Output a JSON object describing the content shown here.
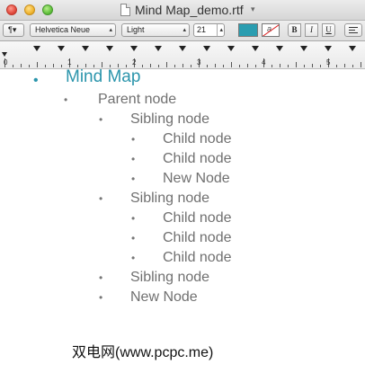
{
  "window": {
    "title": "Mind Map_demo.rtf",
    "title_menu_arrow": "▾"
  },
  "toolbar": {
    "paragraph_symbol": "¶▾",
    "font_family": "Helvetica Neue",
    "font_style": "Light",
    "font_size": "21",
    "text_color": "#2a9db0",
    "highlight_glyph": "a",
    "bold": "B",
    "italic": "I",
    "underline": "U"
  },
  "ruler": {
    "numbers": [
      "0",
      "1",
      "2",
      "3",
      "4",
      "5"
    ]
  },
  "document": {
    "items": [
      {
        "level": 0,
        "text": "Mind Map"
      },
      {
        "level": 1,
        "text": "Parent node"
      },
      {
        "level": 2,
        "text": "Sibling node"
      },
      {
        "level": 3,
        "text": "Child node"
      },
      {
        "level": 3,
        "text": "Child node"
      },
      {
        "level": 3,
        "text": "New Node"
      },
      {
        "level": 2,
        "text": "Sibling node"
      },
      {
        "level": 3,
        "text": "Child node"
      },
      {
        "level": 3,
        "text": "Child node"
      },
      {
        "level": 3,
        "text": "Child node"
      },
      {
        "level": 2,
        "text": "Sibling node"
      },
      {
        "level": 2,
        "text": "New Node"
      }
    ],
    "bullet": "•",
    "accent_color": "#2b95ac",
    "text_color": "#707070"
  },
  "watermark": "双电网(www.pcpc.me)"
}
